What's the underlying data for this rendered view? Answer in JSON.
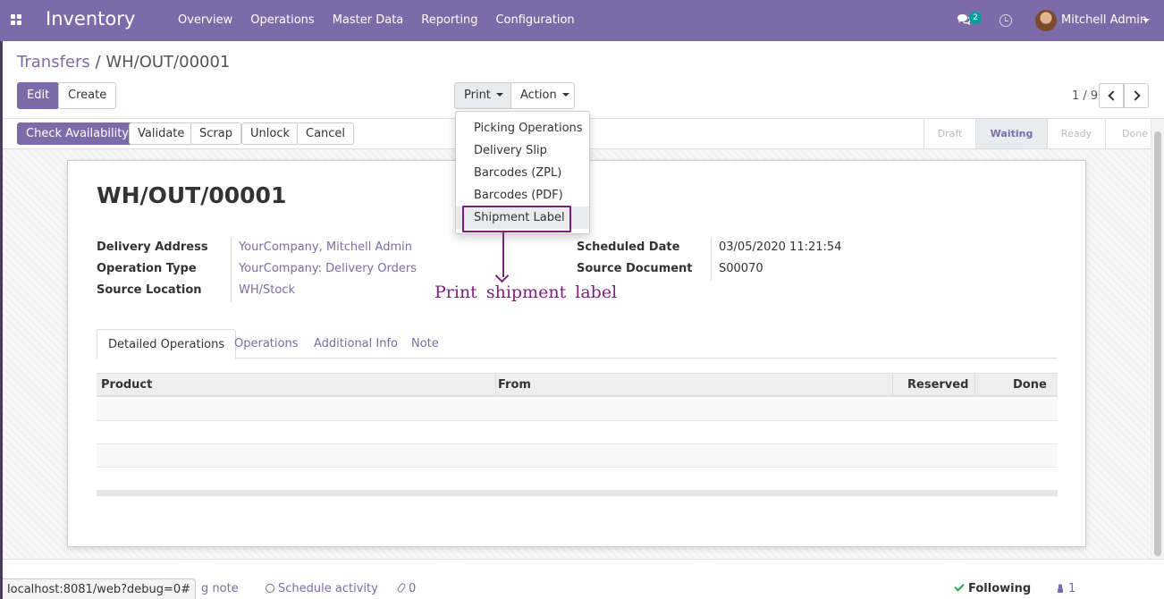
{
  "navbar": {
    "brand": "Inventory",
    "menu": [
      "Overview",
      "Operations",
      "Master Data",
      "Reporting",
      "Configuration"
    ],
    "chat_count": "2",
    "user_name": "Mitchell Admin",
    "bg_color": "#7c6ba8"
  },
  "breadcrumb": {
    "parent": "Transfers",
    "separator": "/",
    "current": "WH/OUT/00001"
  },
  "toolbar": {
    "edit": "Edit",
    "create": "Create",
    "print": "Print",
    "action": "Action"
  },
  "pager": {
    "value": "1 / 9"
  },
  "header_buttons": {
    "check_availability": "Check Availability",
    "validate": "Validate",
    "scrap": "Scrap",
    "unlock": "Unlock",
    "cancel": "Cancel"
  },
  "status_steps": [
    "Draft",
    "Waiting",
    "Ready",
    "Done"
  ],
  "status_active": "Waiting",
  "print_menu": {
    "items": [
      "Picking Operations",
      "Delivery Slip",
      "Barcodes (ZPL)",
      "Barcodes (PDF)",
      "Shipment Label"
    ],
    "highlighted": "Shipment Label"
  },
  "annotation": {
    "text": "Print shipment label",
    "color": "#7d1f7d"
  },
  "record": {
    "title": "WH/OUT/00001",
    "left_fields": [
      {
        "label": "Delivery Address",
        "value": "YourCompany, Mitchell Admin"
      },
      {
        "label": "Operation Type",
        "value": "YourCompany: Delivery Orders"
      },
      {
        "label": "Source Location",
        "value": "WH/Stock"
      }
    ],
    "right_fields": [
      {
        "label": "Scheduled Date",
        "value": "03/05/2020 11:21:54"
      },
      {
        "label": "Source Document",
        "value": "S00070"
      }
    ]
  },
  "tabs": [
    "Detailed Operations",
    "Operations",
    "Additional Info",
    "Note"
  ],
  "table": {
    "columns": [
      "Product",
      "From",
      "Reserved",
      "Done"
    ]
  },
  "chatter": {
    "log_note_fragment": "g note",
    "schedule_activity": "Schedule activity",
    "attachments": "0",
    "following": "Following",
    "followers": "1"
  },
  "status_url": "localhost:8081/web?debug=0#"
}
